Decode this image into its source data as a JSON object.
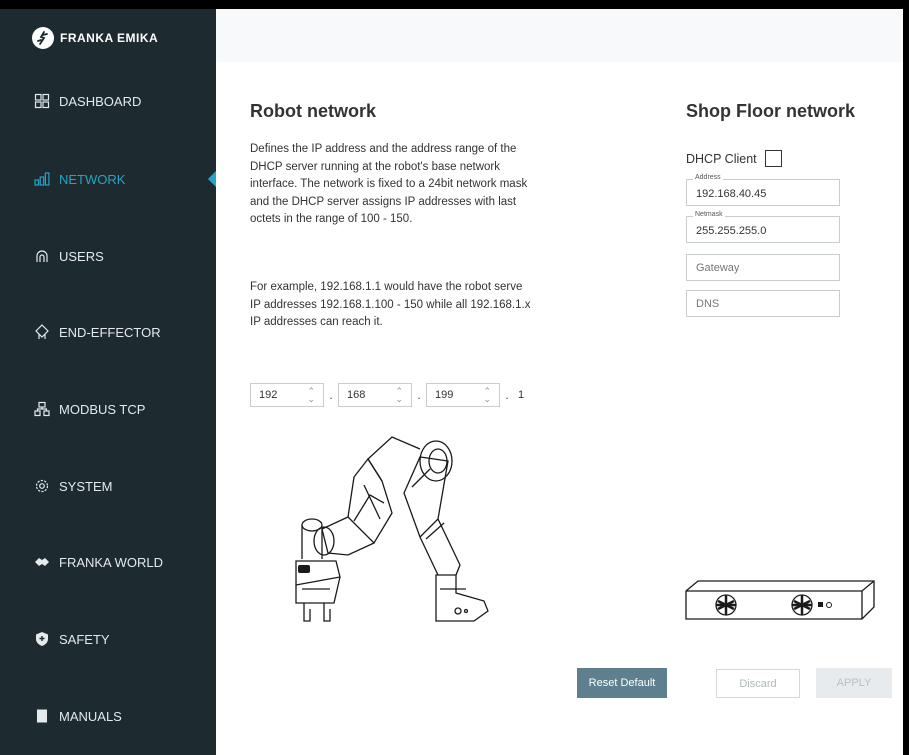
{
  "brand": {
    "name": "FRANKA EMIKA"
  },
  "sidebar": {
    "items": [
      {
        "label": "DASHBOARD",
        "icon": "dashboard-icon",
        "active": false
      },
      {
        "label": "NETWORK",
        "icon": "network-icon",
        "active": true
      },
      {
        "label": "USERS",
        "icon": "users-icon",
        "active": false
      },
      {
        "label": "END-EFFECTOR",
        "icon": "end-effector-icon",
        "active": false
      },
      {
        "label": "MODBUS TCP",
        "icon": "modbus-icon",
        "active": false
      },
      {
        "label": "SYSTEM",
        "icon": "gear-icon",
        "active": false
      },
      {
        "label": "FRANKA WORLD",
        "icon": "franka-world-icon",
        "active": false
      },
      {
        "label": "SAFETY",
        "icon": "shield-icon",
        "active": false
      },
      {
        "label": "MANUALS",
        "icon": "book-icon",
        "active": false
      }
    ]
  },
  "robot_network": {
    "title": "Robot network",
    "description": "Defines the IP address and the address range of the DHCP server running at the robot's base network interface. The network is fixed to a 24bit network mask and the DHCP server assigns IP addresses with last octets in the range of 100 - 150.",
    "example": "For example, 192.168.1.1 would have the robot serve IP addresses 192.168.1.100 - 150 while all 192.168.1.x IP addresses can reach it.",
    "ip": {
      "octet1": "192",
      "octet2": "168",
      "octet3": "199",
      "octet4": "1",
      "separator": "."
    }
  },
  "shop_floor": {
    "title": "Shop Floor network",
    "dhcp_label": "DHCP Client",
    "dhcp_checked": false,
    "address_label": "Address",
    "address_value": "192.168.40.45",
    "netmask_label": "Netmask",
    "netmask_value": "255.255.255.0",
    "gateway_placeholder": "Gateway",
    "dns_placeholder": "DNS"
  },
  "actions": {
    "reset_label": "Reset Default",
    "discard_label": "Discard",
    "apply_label": "APPLY"
  },
  "colors": {
    "sidebar_bg": "#1d2a30",
    "accent": "#27a3c6",
    "reset_bg": "#5d7f8e"
  }
}
